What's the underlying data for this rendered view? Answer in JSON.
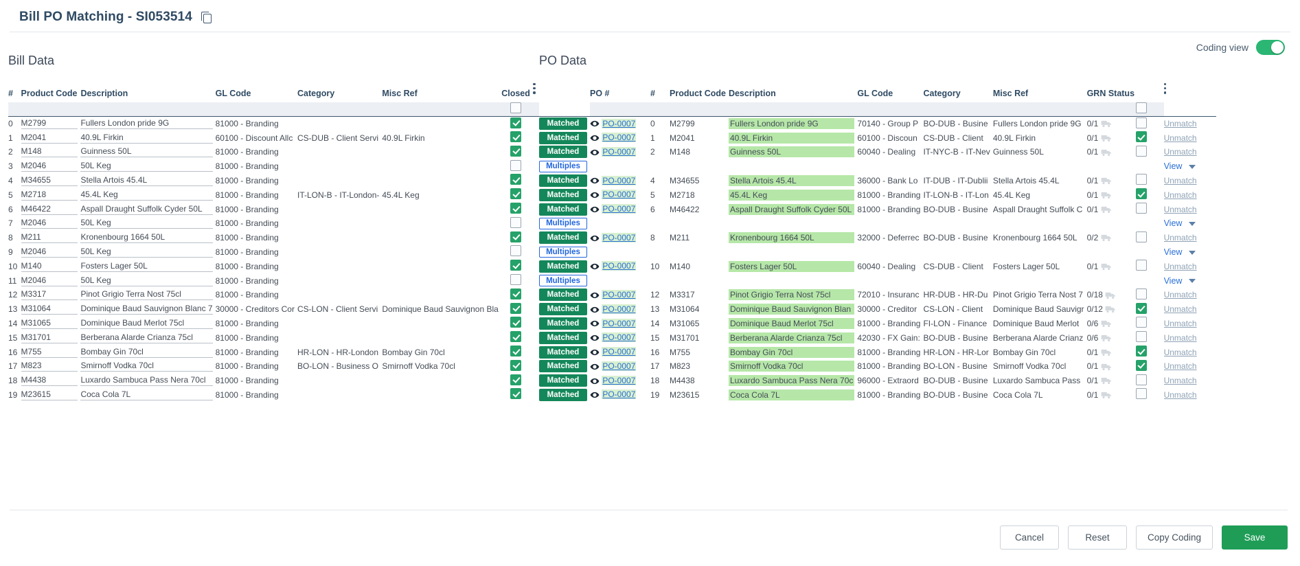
{
  "header": {
    "title": "Bill PO Matching - SI053514",
    "copy_icon": "copy-icon"
  },
  "coding_view": {
    "label": "Coding view",
    "enabled": true,
    "accent": "#2bb673"
  },
  "bill_pane": {
    "title": "Bill Data",
    "columns": [
      "#",
      "Product Code",
      "Description",
      "GL Code",
      "Category",
      "Misc Ref",
      "Closed"
    ],
    "rows": [
      {
        "idx": "0",
        "product_code": "M2799",
        "description": "Fullers London pride 9G",
        "gl_code": "81000 - Branding",
        "category": "",
        "misc_ref": "",
        "closed": true,
        "status": "Matched",
        "action": ""
      },
      {
        "idx": "1",
        "product_code": "M2041",
        "description": "40.9L Firkin",
        "gl_code": "60100 - Discount Allc",
        "category": "CS-DUB - Client Servi",
        "misc_ref": "40.9L Firkin",
        "closed": true,
        "status": "Matched",
        "action": ""
      },
      {
        "idx": "2",
        "product_code": "M148",
        "description": "Guinness  50L",
        "gl_code": "81000 - Branding",
        "category": "",
        "misc_ref": "",
        "closed": true,
        "status": "Matched",
        "action": ""
      },
      {
        "idx": "3",
        "product_code": "M2046",
        "description": "50L Keg",
        "gl_code": "81000 - Branding",
        "category": "",
        "misc_ref": "",
        "closed": false,
        "status": "Multiples",
        "action": "View"
      },
      {
        "idx": "4",
        "product_code": "M34655",
        "description": "Stella Artois  45.4L",
        "gl_code": "81000 - Branding",
        "category": "",
        "misc_ref": "",
        "closed": true,
        "status": "Matched",
        "action": ""
      },
      {
        "idx": "5",
        "product_code": "M2718",
        "description": "45.4L Keg",
        "gl_code": "81000 - Branding",
        "category": "IT-LON-B - IT-London-",
        "misc_ref": "45.4L Keg",
        "closed": true,
        "status": "Matched",
        "action": ""
      },
      {
        "idx": "6",
        "product_code": "M46422",
        "description": "Aspall Draught Suffolk Cyder 50L",
        "gl_code": "81000 - Branding",
        "category": "",
        "misc_ref": "",
        "closed": true,
        "status": "Matched",
        "action": ""
      },
      {
        "idx": "7",
        "product_code": "M2046",
        "description": "50L Keg",
        "gl_code": "81000 - Branding",
        "category": "",
        "misc_ref": "",
        "closed": false,
        "status": "Multiples",
        "action": "View"
      },
      {
        "idx": "8",
        "product_code": "M211",
        "description": "Kronenbourg 1664  50L",
        "gl_code": "81000 - Branding",
        "category": "",
        "misc_ref": "",
        "closed": true,
        "status": "Matched",
        "action": ""
      },
      {
        "idx": "9",
        "product_code": "M2046",
        "description": "50L Keg",
        "gl_code": "81000 - Branding",
        "category": "",
        "misc_ref": "",
        "closed": false,
        "status": "Multiples",
        "action": "View"
      },
      {
        "idx": "10",
        "product_code": "M140",
        "description": "Fosters Lager  50L",
        "gl_code": "81000 - Branding",
        "category": "",
        "misc_ref": "",
        "closed": true,
        "status": "Matched",
        "action": ""
      },
      {
        "idx": "11",
        "product_code": "M2046",
        "description": "50L Keg",
        "gl_code": "81000 - Branding",
        "category": "",
        "misc_ref": "",
        "closed": false,
        "status": "Multiples",
        "action": "View"
      },
      {
        "idx": "12",
        "product_code": "M3317",
        "description": "Pinot Grigio Terra Nost  75cl",
        "gl_code": "81000 - Branding",
        "category": "",
        "misc_ref": "",
        "closed": true,
        "status": "Matched",
        "action": ""
      },
      {
        "idx": "13",
        "product_code": "M31064",
        "description": "Dominique Baud Sauvignon Blanc  7",
        "gl_code": "30000 - Creditors Cor",
        "category": "CS-LON - Client Servi",
        "misc_ref": "Dominique Baud Sauvignon Bla",
        "closed": true,
        "status": "Matched",
        "action": ""
      },
      {
        "idx": "14",
        "product_code": "M31065",
        "description": "Dominique Baud Merlot  75cl",
        "gl_code": "81000 - Branding",
        "category": "",
        "misc_ref": "",
        "closed": true,
        "status": "Matched",
        "action": ""
      },
      {
        "idx": "15",
        "product_code": "M31701",
        "description": "Berberana Alarde Crianza  75cl",
        "gl_code": "81000 - Branding",
        "category": "",
        "misc_ref": "",
        "closed": true,
        "status": "Matched",
        "action": ""
      },
      {
        "idx": "16",
        "product_code": "M755",
        "description": "Bombay Gin  70cl",
        "gl_code": "81000 - Branding",
        "category": "HR-LON - HR-London",
        "misc_ref": "Bombay Gin 70cl",
        "closed": true,
        "status": "Matched",
        "action": ""
      },
      {
        "idx": "17",
        "product_code": "M823",
        "description": "Smirnoff Vodka  70cl",
        "gl_code": "81000 - Branding",
        "category": "BO-LON - Business O",
        "misc_ref": "Smirnoff Vodka 70cl",
        "closed": true,
        "status": "Matched",
        "action": ""
      },
      {
        "idx": "18",
        "product_code": "M4438",
        "description": "Luxardo Sambuca Pass Nera  70cl",
        "gl_code": "81000 - Branding",
        "category": "",
        "misc_ref": "",
        "closed": true,
        "status": "Matched",
        "action": ""
      },
      {
        "idx": "19",
        "product_code": "M23615",
        "description": "Coca Cola  7L",
        "gl_code": "81000 - Branding",
        "category": "",
        "misc_ref": "",
        "closed": true,
        "status": "Matched",
        "action": ""
      }
    ]
  },
  "po_pane": {
    "title": "PO Data",
    "columns": [
      "PO #",
      "#",
      "Product Code",
      "Description",
      "GL Code",
      "Category",
      "Misc Ref",
      "GRN Status"
    ],
    "unmatch_label": "Unmatch",
    "rows": [
      {
        "po": "PO-0007",
        "idx": "0",
        "product_code": "M2799",
        "description": "Fullers London pride 9G",
        "gl_code": "70140 - Group P",
        "category": "BO-DUB - Busine",
        "misc_ref": "Fullers London pride 9G",
        "grn": "0/1",
        "closed": false
      },
      {
        "po": "PO-0007",
        "idx": "1",
        "product_code": "M2041",
        "description": "40.9L Firkin",
        "gl_code": "60100 - Discoun",
        "category": "CS-DUB - Client ",
        "misc_ref": "40.9L Firkin",
        "grn": "0/1",
        "closed": true
      },
      {
        "po": "PO-0007",
        "idx": "2",
        "product_code": "M148",
        "description": "Guinness 50L",
        "gl_code": "60040 - Dealing",
        "category": "IT-NYC-B - IT-Nev",
        "misc_ref": "Guinness 50L",
        "grn": "0/1",
        "closed": false
      },
      {
        "po": "",
        "idx": "",
        "product_code": "",
        "description": "",
        "gl_code": "",
        "category": "",
        "misc_ref": "",
        "grn": "",
        "closed": null
      },
      {
        "po": "PO-0007",
        "idx": "4",
        "product_code": "M34655",
        "description": "Stella Artois 45.4L",
        "gl_code": "36000 - Bank Lo",
        "category": "IT-DUB - IT-Dublii",
        "misc_ref": "Stella Artois 45.4L",
        "grn": "0/1",
        "closed": false
      },
      {
        "po": "PO-0007",
        "idx": "5",
        "product_code": "M2718",
        "description": "45.4L Keg",
        "gl_code": "81000 - Branding",
        "category": "IT-LON-B - IT-Lon",
        "misc_ref": "45.4L Keg",
        "grn": "0/1",
        "closed": true
      },
      {
        "po": "PO-0007",
        "idx": "6",
        "product_code": "M46422",
        "description": "Aspall Draught Suffolk Cyder 50L",
        "gl_code": "81000 - Branding",
        "category": "BO-DUB - Busine",
        "misc_ref": "Aspall Draught Suffolk C",
        "grn": "0/1",
        "closed": false
      },
      {
        "po": "",
        "idx": "",
        "product_code": "",
        "description": "",
        "gl_code": "",
        "category": "",
        "misc_ref": "",
        "grn": "",
        "closed": null
      },
      {
        "po": "PO-0007",
        "idx": "8",
        "product_code": "M211",
        "description": "Kronenbourg 1664 50L",
        "gl_code": "32000 - Deferrec",
        "category": "BO-DUB - Busine",
        "misc_ref": "Kronenbourg 1664 50L",
        "grn": "0/2",
        "closed": false
      },
      {
        "po": "",
        "idx": "",
        "product_code": "",
        "description": "",
        "gl_code": "",
        "category": "",
        "misc_ref": "",
        "grn": "",
        "closed": null
      },
      {
        "po": "PO-0007",
        "idx": "10",
        "product_code": "M140",
        "description": "Fosters Lager 50L",
        "gl_code": "60040 - Dealing",
        "category": "CS-DUB - Client ",
        "misc_ref": "Fosters Lager 50L",
        "grn": "0/1",
        "closed": false
      },
      {
        "po": "",
        "idx": "",
        "product_code": "",
        "description": "",
        "gl_code": "",
        "category": "",
        "misc_ref": "",
        "grn": "",
        "closed": null
      },
      {
        "po": "PO-0007",
        "idx": "12",
        "product_code": "M3317",
        "description": "Pinot Grigio Terra Nost 75cl",
        "gl_code": "72010 - Insuranc",
        "category": "HR-DUB - HR-Du",
        "misc_ref": "Pinot Grigio Terra Nost 7",
        "grn": "0/18",
        "closed": false
      },
      {
        "po": "PO-0007",
        "idx": "13",
        "product_code": "M31064",
        "description": "Dominique Baud Sauvignon Blan",
        "gl_code": "30000 - Creditor",
        "category": "CS-LON - Client ",
        "misc_ref": "Dominique Baud Sauvigr",
        "grn": "0/12",
        "closed": true
      },
      {
        "po": "PO-0007",
        "idx": "14",
        "product_code": "M31065",
        "description": "Dominique Baud Merlot 75cl",
        "gl_code": "81000 - Branding",
        "category": "FI-LON - Finance",
        "misc_ref": "Dominique Baud Merlot ",
        "grn": "0/6",
        "closed": false
      },
      {
        "po": "PO-0007",
        "idx": "15",
        "product_code": "M31701",
        "description": "Berberana Alarde Crianza 75cl",
        "gl_code": "42030 - FX Gain:",
        "category": "BO-DUB - Busine",
        "misc_ref": "Berberana Alarde Crianz",
        "grn": "0/6",
        "closed": false
      },
      {
        "po": "PO-0007",
        "idx": "16",
        "product_code": "M755",
        "description": "Bombay Gin 70cl",
        "gl_code": "81000 - Branding",
        "category": "HR-LON - HR-Lor",
        "misc_ref": "Bombay Gin 70cl",
        "grn": "0/1",
        "closed": true
      },
      {
        "po": "PO-0007",
        "idx": "17",
        "product_code": "M823",
        "description": "Smirnoff Vodka 70cl",
        "gl_code": "81000 - Branding",
        "category": "BO-LON - Busine",
        "misc_ref": "Smirnoff Vodka 70cl",
        "grn": "0/1",
        "closed": true
      },
      {
        "po": "PO-0007",
        "idx": "18",
        "product_code": "M4438",
        "description": "Luxardo Sambuca Pass Nera 70c",
        "gl_code": "96000 - Extraord",
        "category": "BO-DUB - Busine",
        "misc_ref": "Luxardo Sambuca Pass ",
        "grn": "0/1",
        "closed": false
      },
      {
        "po": "PO-0007",
        "idx": "19",
        "product_code": "M23615",
        "description": "Coca Cola 7L",
        "gl_code": "81000 - Branding",
        "category": "BO-DUB - Busine",
        "misc_ref": "Coca Cola 7L",
        "grn": "0/1",
        "closed": false
      }
    ]
  },
  "footer": {
    "cancel": "Cancel",
    "reset": "Reset",
    "copy_coding": "Copy Coding",
    "save": "Save"
  }
}
